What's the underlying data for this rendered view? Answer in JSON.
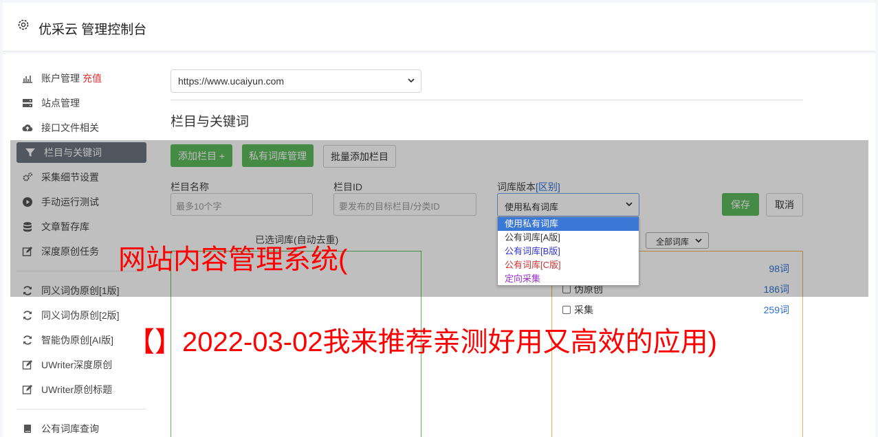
{
  "app": {
    "title": "优采云 管理控制台"
  },
  "sidebar": {
    "items": [
      {
        "label": "账户管理",
        "badge": "充值",
        "icon": "bar-chart-icon"
      },
      {
        "label": "站点管理",
        "icon": "server-icon"
      },
      {
        "label": "接口文件相关",
        "icon": "cloud-upload-icon"
      },
      {
        "label": "栏目与关键词",
        "icon": "filter-icon"
      },
      {
        "label": "采集细节设置",
        "icon": "cogs-icon"
      },
      {
        "label": "手动运行测试",
        "icon": "play-circle-icon"
      },
      {
        "label": "文章暂存库",
        "icon": "database-icon"
      },
      {
        "label": "深度原创任务",
        "icon": "edit-icon"
      },
      {
        "label": "同义词伪原创[1版]",
        "icon": "refresh-icon"
      },
      {
        "label": "同义词伪原创[2版]",
        "icon": "refresh-icon"
      },
      {
        "label": "智能伪原创[AI版]",
        "icon": "refresh-icon"
      },
      {
        "label": "UWriter深度原创",
        "icon": "edit-icon"
      },
      {
        "label": "UWriter原创标题",
        "icon": "edit-icon"
      },
      {
        "label": "公有词库查询",
        "icon": "book-icon"
      }
    ]
  },
  "site_select": {
    "value": "https://www.ucaiyun.com"
  },
  "section": {
    "title": "栏目与关键词"
  },
  "toolbar": {
    "add_column": "添加栏目 +",
    "private_lib": "私有词库管理",
    "batch_add": "批量添加栏目"
  },
  "form": {
    "name_label": "栏目名称",
    "name_placeholder": "最多10个字",
    "id_label": "栏目ID",
    "id_placeholder": "要发布的目标栏目/分类ID",
    "version_label": "词库版本",
    "version_link": "[区别]",
    "version_value": "使用私有词库",
    "save": "保存",
    "cancel": "取消"
  },
  "dropdown": {
    "options": [
      {
        "label": "使用私有词库",
        "color": "#ffffff"
      },
      {
        "label": "公有词库[A版]",
        "color": "#333333"
      },
      {
        "label": "公有词库[B版]",
        "color": "#3333cc"
      },
      {
        "label": "公有词库[C版]",
        "color": "#cc3333"
      },
      {
        "label": "定向采集",
        "color": "#9933cc"
      }
    ]
  },
  "libs": {
    "selected_caption": "已选词库(自动去重)",
    "filter_value": "全部词库",
    "rows": [
      {
        "label": "",
        "count": "98词"
      },
      {
        "label": "伪原创",
        "count": "186词"
      },
      {
        "label": "采集",
        "count": "259词"
      }
    ]
  },
  "overlay": {
    "line1": "网站内容管理系统(",
    "line2": "【】2022-03-02我来推荐亲测好用又高效的应用)"
  }
}
